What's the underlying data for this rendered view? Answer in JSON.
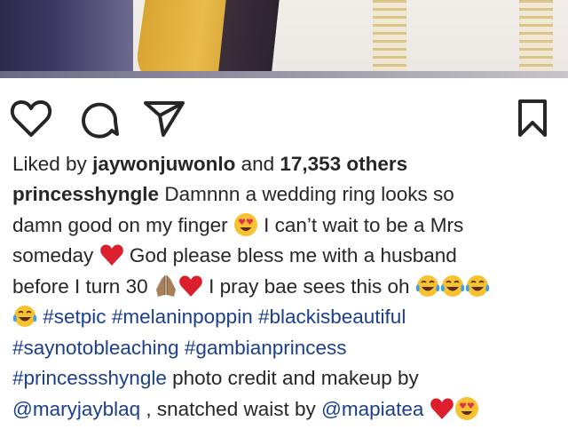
{
  "post": {
    "liked_prefix": "Liked by ",
    "liked_user": "jaywonjuwonlo",
    "liked_and": " and ",
    "liked_others": "17,353 others",
    "author": "princesshyngle",
    "caption": {
      "line1": " Damnnn a wedding ring looks so",
      "line2a": "damn good on my finger ",
      "line2b": " I can’t wait to be a Mrs",
      "line3a": "someday ",
      "line3b": " God please bless me with a husband",
      "line4a": "before I turn 30 ",
      "line4b": " I pray bae sees this oh ",
      "tags": [
        "#setpic",
        "#melaninpoppin",
        "#blackisbeautiful",
        "#saynotobleaching",
        "#gambianprincess",
        "#princessshyngle"
      ],
      "credit": "  photo credit and makeup by",
      "mention1": "@maryjayblaq",
      "waist": " , snatched waist by ",
      "mention2": "@mapiatea"
    },
    "emojis": [
      "heart-eyes-emoji",
      "red-heart-emoji",
      "folded-hands-emoji",
      "tears-of-joy-emoji"
    ]
  },
  "actions": {
    "icons": [
      "heart-icon",
      "comment-icon",
      "share-icon",
      "bookmark-icon"
    ]
  }
}
